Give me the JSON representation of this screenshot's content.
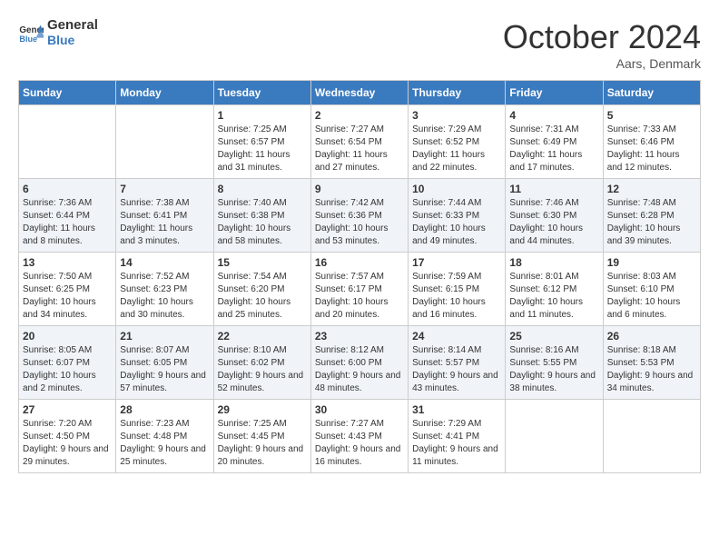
{
  "header": {
    "logo_line1": "General",
    "logo_line2": "Blue",
    "month": "October 2024",
    "location": "Aars, Denmark"
  },
  "weekdays": [
    "Sunday",
    "Monday",
    "Tuesday",
    "Wednesday",
    "Thursday",
    "Friday",
    "Saturday"
  ],
  "weeks": [
    [
      {
        "day": "",
        "info": ""
      },
      {
        "day": "",
        "info": ""
      },
      {
        "day": "1",
        "info": "Sunrise: 7:25 AM\nSunset: 6:57 PM\nDaylight: 11 hours and 31 minutes."
      },
      {
        "day": "2",
        "info": "Sunrise: 7:27 AM\nSunset: 6:54 PM\nDaylight: 11 hours and 27 minutes."
      },
      {
        "day": "3",
        "info": "Sunrise: 7:29 AM\nSunset: 6:52 PM\nDaylight: 11 hours and 22 minutes."
      },
      {
        "day": "4",
        "info": "Sunrise: 7:31 AM\nSunset: 6:49 PM\nDaylight: 11 hours and 17 minutes."
      },
      {
        "day": "5",
        "info": "Sunrise: 7:33 AM\nSunset: 6:46 PM\nDaylight: 11 hours and 12 minutes."
      }
    ],
    [
      {
        "day": "6",
        "info": "Sunrise: 7:36 AM\nSunset: 6:44 PM\nDaylight: 11 hours and 8 minutes."
      },
      {
        "day": "7",
        "info": "Sunrise: 7:38 AM\nSunset: 6:41 PM\nDaylight: 11 hours and 3 minutes."
      },
      {
        "day": "8",
        "info": "Sunrise: 7:40 AM\nSunset: 6:38 PM\nDaylight: 10 hours and 58 minutes."
      },
      {
        "day": "9",
        "info": "Sunrise: 7:42 AM\nSunset: 6:36 PM\nDaylight: 10 hours and 53 minutes."
      },
      {
        "day": "10",
        "info": "Sunrise: 7:44 AM\nSunset: 6:33 PM\nDaylight: 10 hours and 49 minutes."
      },
      {
        "day": "11",
        "info": "Sunrise: 7:46 AM\nSunset: 6:30 PM\nDaylight: 10 hours and 44 minutes."
      },
      {
        "day": "12",
        "info": "Sunrise: 7:48 AM\nSunset: 6:28 PM\nDaylight: 10 hours and 39 minutes."
      }
    ],
    [
      {
        "day": "13",
        "info": "Sunrise: 7:50 AM\nSunset: 6:25 PM\nDaylight: 10 hours and 34 minutes."
      },
      {
        "day": "14",
        "info": "Sunrise: 7:52 AM\nSunset: 6:23 PM\nDaylight: 10 hours and 30 minutes."
      },
      {
        "day": "15",
        "info": "Sunrise: 7:54 AM\nSunset: 6:20 PM\nDaylight: 10 hours and 25 minutes."
      },
      {
        "day": "16",
        "info": "Sunrise: 7:57 AM\nSunset: 6:17 PM\nDaylight: 10 hours and 20 minutes."
      },
      {
        "day": "17",
        "info": "Sunrise: 7:59 AM\nSunset: 6:15 PM\nDaylight: 10 hours and 16 minutes."
      },
      {
        "day": "18",
        "info": "Sunrise: 8:01 AM\nSunset: 6:12 PM\nDaylight: 10 hours and 11 minutes."
      },
      {
        "day": "19",
        "info": "Sunrise: 8:03 AM\nSunset: 6:10 PM\nDaylight: 10 hours and 6 minutes."
      }
    ],
    [
      {
        "day": "20",
        "info": "Sunrise: 8:05 AM\nSunset: 6:07 PM\nDaylight: 10 hours and 2 minutes."
      },
      {
        "day": "21",
        "info": "Sunrise: 8:07 AM\nSunset: 6:05 PM\nDaylight: 9 hours and 57 minutes."
      },
      {
        "day": "22",
        "info": "Sunrise: 8:10 AM\nSunset: 6:02 PM\nDaylight: 9 hours and 52 minutes."
      },
      {
        "day": "23",
        "info": "Sunrise: 8:12 AM\nSunset: 6:00 PM\nDaylight: 9 hours and 48 minutes."
      },
      {
        "day": "24",
        "info": "Sunrise: 8:14 AM\nSunset: 5:57 PM\nDaylight: 9 hours and 43 minutes."
      },
      {
        "day": "25",
        "info": "Sunrise: 8:16 AM\nSunset: 5:55 PM\nDaylight: 9 hours and 38 minutes."
      },
      {
        "day": "26",
        "info": "Sunrise: 8:18 AM\nSunset: 5:53 PM\nDaylight: 9 hours and 34 minutes."
      }
    ],
    [
      {
        "day": "27",
        "info": "Sunrise: 7:20 AM\nSunset: 4:50 PM\nDaylight: 9 hours and 29 minutes."
      },
      {
        "day": "28",
        "info": "Sunrise: 7:23 AM\nSunset: 4:48 PM\nDaylight: 9 hours and 25 minutes."
      },
      {
        "day": "29",
        "info": "Sunrise: 7:25 AM\nSunset: 4:45 PM\nDaylight: 9 hours and 20 minutes."
      },
      {
        "day": "30",
        "info": "Sunrise: 7:27 AM\nSunset: 4:43 PM\nDaylight: 9 hours and 16 minutes."
      },
      {
        "day": "31",
        "info": "Sunrise: 7:29 AM\nSunset: 4:41 PM\nDaylight: 9 hours and 11 minutes."
      },
      {
        "day": "",
        "info": ""
      },
      {
        "day": "",
        "info": ""
      }
    ]
  ]
}
